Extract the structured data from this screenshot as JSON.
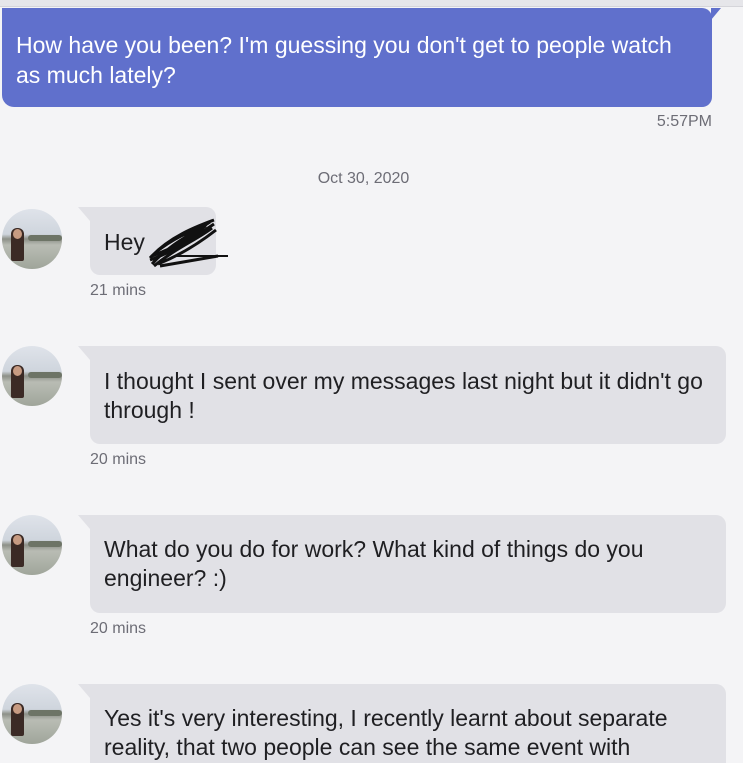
{
  "outgoing": {
    "text": "How have you been? I'm guessing you don't get to people watch as much lately?",
    "time": "5:57PM"
  },
  "date_separator": "Oct 30, 2020",
  "incoming": [
    {
      "text": "Hey",
      "time": "21 mins"
    },
    {
      "text": "I thought I sent over my messages last night but it didn't go through !",
      "time": "20 mins"
    },
    {
      "text": "What do you do for work? What kind of things do you engineer? :)",
      "time": "20 mins"
    },
    {
      "text": "Yes it's very interesting, I recently learnt about separate reality, that two people can see the same event with"
    }
  ],
  "colors": {
    "outgoing_bubble": "#6070cc",
    "incoming_bubble": "#e1e1e6",
    "background": "#f4f4f6"
  }
}
